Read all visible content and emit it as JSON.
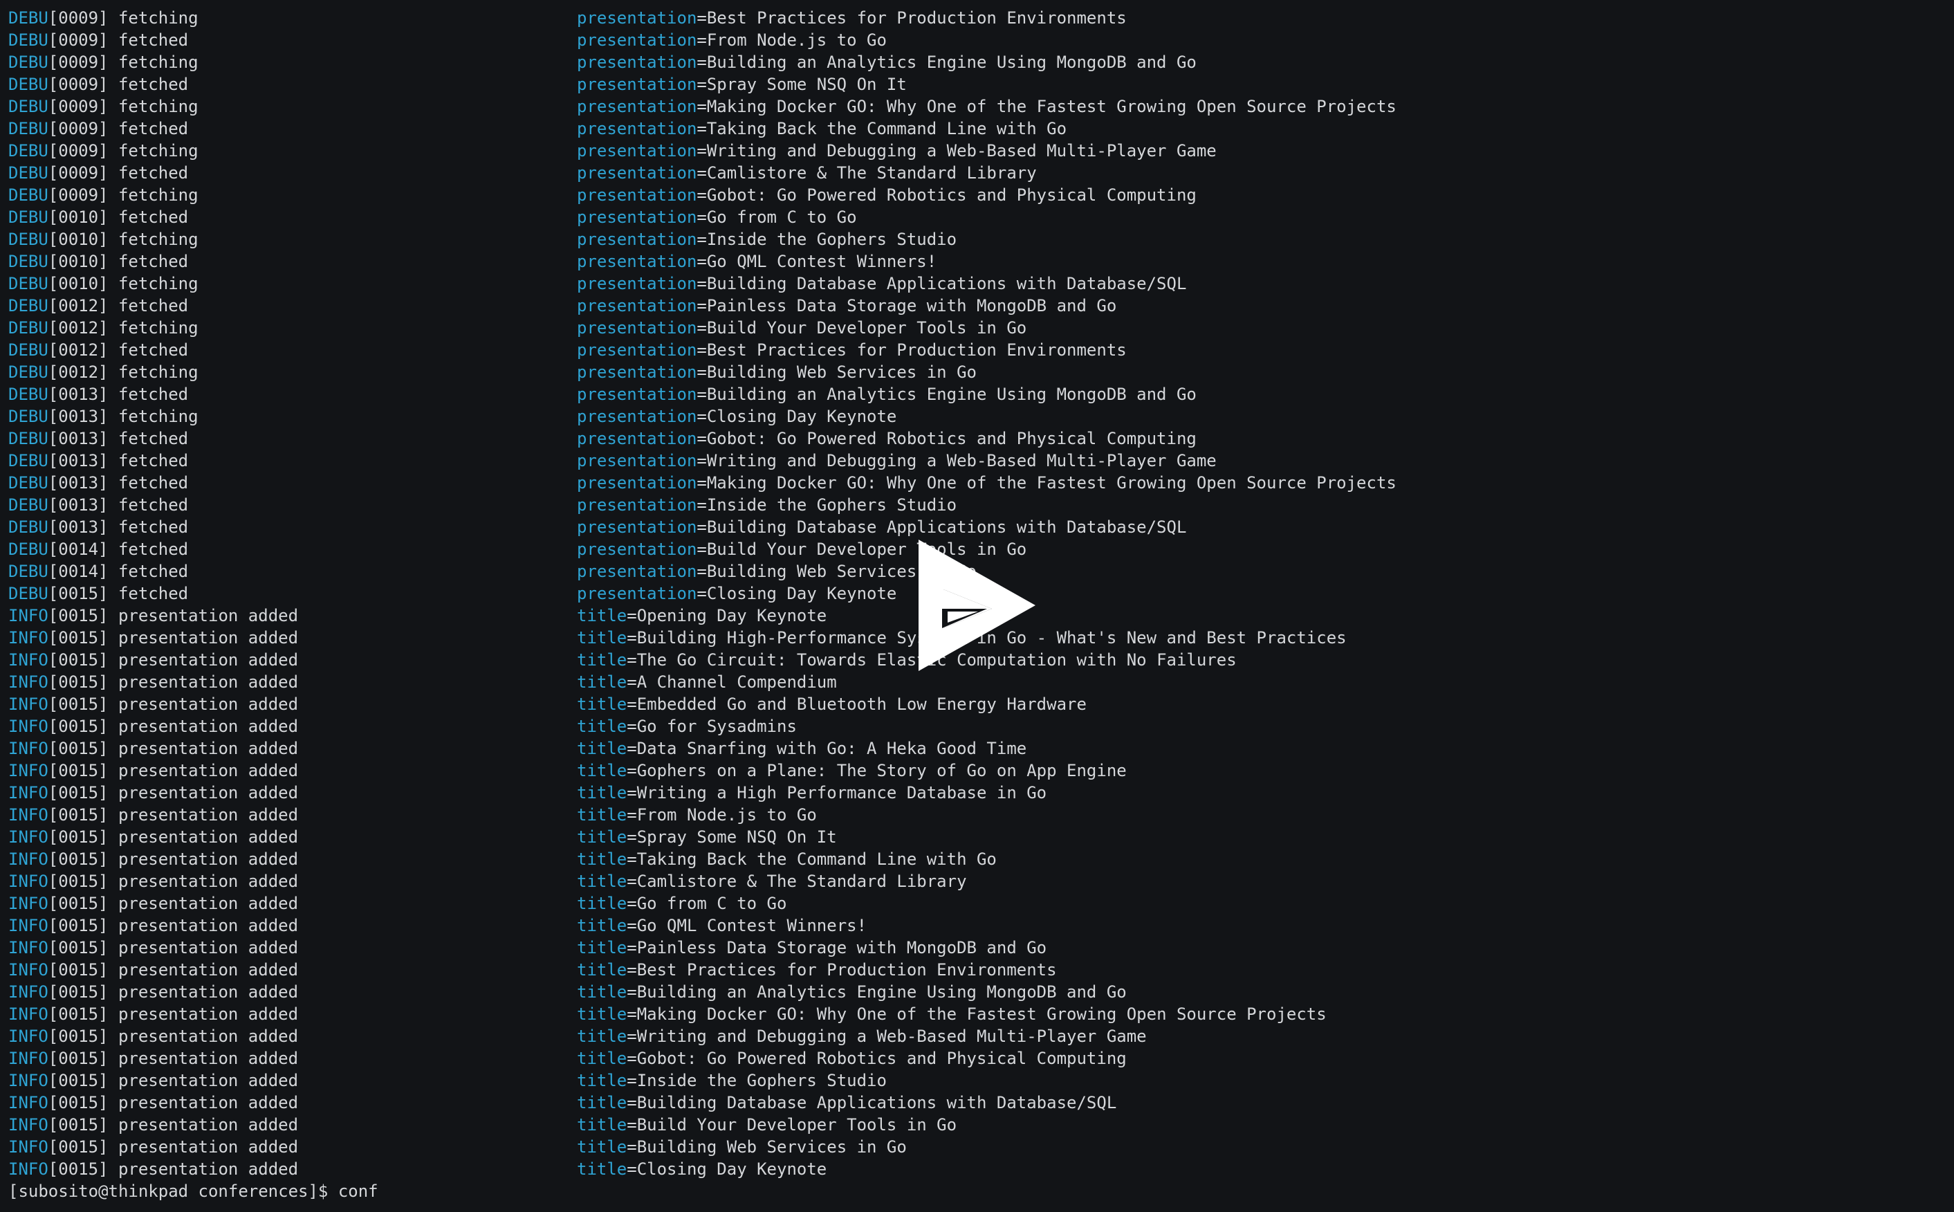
{
  "terminal": {
    "lines": [
      {
        "level": "DEBU",
        "seq": "[0009]",
        "msg": "fetching",
        "key": "presentation",
        "value": "Best Practices for Production Environments"
      },
      {
        "level": "DEBU",
        "seq": "[0009]",
        "msg": "fetched",
        "key": "presentation",
        "value": "From Node.js to Go"
      },
      {
        "level": "DEBU",
        "seq": "[0009]",
        "msg": "fetching",
        "key": "presentation",
        "value": "Building an Analytics Engine Using MongoDB and Go"
      },
      {
        "level": "DEBU",
        "seq": "[0009]",
        "msg": "fetched",
        "key": "presentation",
        "value": "Spray Some NSQ On It"
      },
      {
        "level": "DEBU",
        "seq": "[0009]",
        "msg": "fetching",
        "key": "presentation",
        "value": "Making Docker GO: Why One of the Fastest Growing Open Source Projects"
      },
      {
        "level": "DEBU",
        "seq": "[0009]",
        "msg": "fetched",
        "key": "presentation",
        "value": "Taking Back the Command Line with Go"
      },
      {
        "level": "DEBU",
        "seq": "[0009]",
        "msg": "fetching",
        "key": "presentation",
        "value": "Writing and Debugging a Web-Based Multi-Player Game"
      },
      {
        "level": "DEBU",
        "seq": "[0009]",
        "msg": "fetched",
        "key": "presentation",
        "value": "Camlistore & The Standard Library"
      },
      {
        "level": "DEBU",
        "seq": "[0009]",
        "msg": "fetching",
        "key": "presentation",
        "value": "Gobot: Go Powered Robotics and Physical Computing"
      },
      {
        "level": "DEBU",
        "seq": "[0010]",
        "msg": "fetched",
        "key": "presentation",
        "value": "Go from C to Go"
      },
      {
        "level": "DEBU",
        "seq": "[0010]",
        "msg": "fetching",
        "key": "presentation",
        "value": "Inside the Gophers Studio"
      },
      {
        "level": "DEBU",
        "seq": "[0010]",
        "msg": "fetched",
        "key": "presentation",
        "value": "Go QML Contest Winners!"
      },
      {
        "level": "DEBU",
        "seq": "[0010]",
        "msg": "fetching",
        "key": "presentation",
        "value": "Building Database Applications with Database/SQL"
      },
      {
        "level": "DEBU",
        "seq": "[0012]",
        "msg": "fetched",
        "key": "presentation",
        "value": "Painless Data Storage with MongoDB and Go"
      },
      {
        "level": "DEBU",
        "seq": "[0012]",
        "msg": "fetching",
        "key": "presentation",
        "value": "Build Your Developer Tools in Go"
      },
      {
        "level": "DEBU",
        "seq": "[0012]",
        "msg": "fetched",
        "key": "presentation",
        "value": "Best Practices for Production Environments"
      },
      {
        "level": "DEBU",
        "seq": "[0012]",
        "msg": "fetching",
        "key": "presentation",
        "value": "Building Web Services in Go"
      },
      {
        "level": "DEBU",
        "seq": "[0013]",
        "msg": "fetched",
        "key": "presentation",
        "value": "Building an Analytics Engine Using MongoDB and Go"
      },
      {
        "level": "DEBU",
        "seq": "[0013]",
        "msg": "fetching",
        "key": "presentation",
        "value": "Closing Day Keynote"
      },
      {
        "level": "DEBU",
        "seq": "[0013]",
        "msg": "fetched",
        "key": "presentation",
        "value": "Gobot: Go Powered Robotics and Physical Computing"
      },
      {
        "level": "DEBU",
        "seq": "[0013]",
        "msg": "fetched",
        "key": "presentation",
        "value": "Writing and Debugging a Web-Based Multi-Player Game"
      },
      {
        "level": "DEBU",
        "seq": "[0013]",
        "msg": "fetched",
        "key": "presentation",
        "value": "Making Docker GO: Why One of the Fastest Growing Open Source Projects"
      },
      {
        "level": "DEBU",
        "seq": "[0013]",
        "msg": "fetched",
        "key": "presentation",
        "value": "Inside the Gophers Studio"
      },
      {
        "level": "DEBU",
        "seq": "[0013]",
        "msg": "fetched",
        "key": "presentation",
        "value": "Building Database Applications with Database/SQL"
      },
      {
        "level": "DEBU",
        "seq": "[0014]",
        "msg": "fetched",
        "key": "presentation",
        "value": "Build Your Developer Tools in Go"
      },
      {
        "level": "DEBU",
        "seq": "[0014]",
        "msg": "fetched",
        "key": "presentation",
        "value": "Building Web Services in Go"
      },
      {
        "level": "DEBU",
        "seq": "[0015]",
        "msg": "fetched",
        "key": "presentation",
        "value": "Closing Day Keynote"
      },
      {
        "level": "INFO",
        "seq": "[0015]",
        "msg": "presentation added",
        "key": "title",
        "value": "Opening Day Keynote"
      },
      {
        "level": "INFO",
        "seq": "[0015]",
        "msg": "presentation added",
        "key": "title",
        "value": "Building High-Performance Systems in Go - What's New and Best Practices"
      },
      {
        "level": "INFO",
        "seq": "[0015]",
        "msg": "presentation added",
        "key": "title",
        "value": "The Go Circuit: Towards Elastic Computation with No Failures"
      },
      {
        "level": "INFO",
        "seq": "[0015]",
        "msg": "presentation added",
        "key": "title",
        "value": "A Channel Compendium"
      },
      {
        "level": "INFO",
        "seq": "[0015]",
        "msg": "presentation added",
        "key": "title",
        "value": "Embedded Go and Bluetooth Low Energy Hardware"
      },
      {
        "level": "INFO",
        "seq": "[0015]",
        "msg": "presentation added",
        "key": "title",
        "value": "Go for Sysadmins"
      },
      {
        "level": "INFO",
        "seq": "[0015]",
        "msg": "presentation added",
        "key": "title",
        "value": "Data Snarfing with Go: A Heka Good Time"
      },
      {
        "level": "INFO",
        "seq": "[0015]",
        "msg": "presentation added",
        "key": "title",
        "value": "Gophers on a Plane: The Story of Go on App Engine"
      },
      {
        "level": "INFO",
        "seq": "[0015]",
        "msg": "presentation added",
        "key": "title",
        "value": "Writing a High Performance Database in Go"
      },
      {
        "level": "INFO",
        "seq": "[0015]",
        "msg": "presentation added",
        "key": "title",
        "value": "From Node.js to Go"
      },
      {
        "level": "INFO",
        "seq": "[0015]",
        "msg": "presentation added",
        "key": "title",
        "value": "Spray Some NSQ On It"
      },
      {
        "level": "INFO",
        "seq": "[0015]",
        "msg": "presentation added",
        "key": "title",
        "value": "Taking Back the Command Line with Go"
      },
      {
        "level": "INFO",
        "seq": "[0015]",
        "msg": "presentation added",
        "key": "title",
        "value": "Camlistore & The Standard Library"
      },
      {
        "level": "INFO",
        "seq": "[0015]",
        "msg": "presentation added",
        "key": "title",
        "value": "Go from C to Go"
      },
      {
        "level": "INFO",
        "seq": "[0015]",
        "msg": "presentation added",
        "key": "title",
        "value": "Go QML Contest Winners!"
      },
      {
        "level": "INFO",
        "seq": "[0015]",
        "msg": "presentation added",
        "key": "title",
        "value": "Painless Data Storage with MongoDB and Go"
      },
      {
        "level": "INFO",
        "seq": "[0015]",
        "msg": "presentation added",
        "key": "title",
        "value": "Best Practices for Production Environments"
      },
      {
        "level": "INFO",
        "seq": "[0015]",
        "msg": "presentation added",
        "key": "title",
        "value": "Building an Analytics Engine Using MongoDB and Go"
      },
      {
        "level": "INFO",
        "seq": "[0015]",
        "msg": "presentation added",
        "key": "title",
        "value": "Making Docker GO: Why One of the Fastest Growing Open Source Projects"
      },
      {
        "level": "INFO",
        "seq": "[0015]",
        "msg": "presentation added",
        "key": "title",
        "value": "Writing and Debugging a Web-Based Multi-Player Game"
      },
      {
        "level": "INFO",
        "seq": "[0015]",
        "msg": "presentation added",
        "key": "title",
        "value": "Gobot: Go Powered Robotics and Physical Computing"
      },
      {
        "level": "INFO",
        "seq": "[0015]",
        "msg": "presentation added",
        "key": "title",
        "value": "Inside the Gophers Studio"
      },
      {
        "level": "INFO",
        "seq": "[0015]",
        "msg": "presentation added",
        "key": "title",
        "value": "Building Database Applications with Database/SQL"
      },
      {
        "level": "INFO",
        "seq": "[0015]",
        "msg": "presentation added",
        "key": "title",
        "value": "Build Your Developer Tools in Go"
      },
      {
        "level": "INFO",
        "seq": "[0015]",
        "msg": "presentation added",
        "key": "title",
        "value": "Building Web Services in Go"
      },
      {
        "level": "INFO",
        "seq": "[0015]",
        "msg": "presentation added",
        "key": "title",
        "value": "Closing Day Keynote"
      }
    ],
    "prompt": "[subosito@thinkpad conferences]$ ",
    "command": "conf"
  },
  "overlay": {
    "icon": "play-icon",
    "color": "#ffffff"
  },
  "colors": {
    "background": "#121417",
    "text": "#d5d7da",
    "accent": "#2fa4d4"
  }
}
